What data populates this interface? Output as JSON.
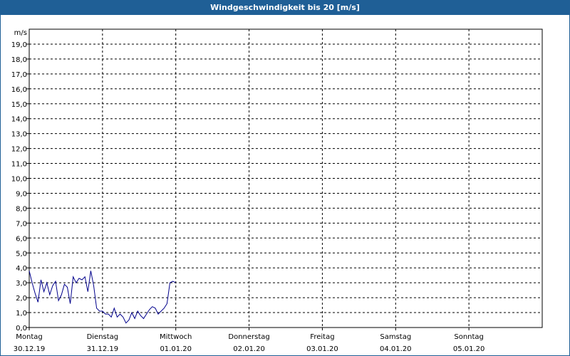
{
  "window": {
    "title": "Windgeschwindigkeit bis 20 [m/s]"
  },
  "colors": {
    "titlebar": "#1f5f96",
    "series": "#00008b",
    "grid": "#000000"
  },
  "chart_data": {
    "type": "line",
    "title": "Windgeschwindigkeit bis 20 [m/s]",
    "ylabel": "m/s",
    "ylim": [
      0,
      20
    ],
    "y_ticks": [
      "0,0",
      "1,0",
      "2,0",
      "3,0",
      "4,0",
      "5,0",
      "6,0",
      "7,0",
      "8,0",
      "9,0",
      "10,0",
      "11,0",
      "12,0",
      "13,0",
      "14,0",
      "15,0",
      "16,0",
      "17,0",
      "18,0",
      "19,0"
    ],
    "x_unit": "days since 30.12.19",
    "xlim": [
      0,
      7
    ],
    "x_ticks": [
      {
        "day": "Montag",
        "date": "30.12.19"
      },
      {
        "day": "Dienstag",
        "date": "31.12.19"
      },
      {
        "day": "Mittwoch",
        "date": "01.01.20"
      },
      {
        "day": "Donnerstag",
        "date": "02.01.20"
      },
      {
        "day": "Freitag",
        "date": "03.01.20"
      },
      {
        "day": "Samstag",
        "date": "04.01.20"
      },
      {
        "day": "Sonntag",
        "date": "05.01.20"
      }
    ],
    "grid": true,
    "series": [
      {
        "name": "",
        "x": [
          0.0,
          0.04,
          0.08,
          0.12,
          0.16,
          0.2,
          0.24,
          0.28,
          0.32,
          0.36,
          0.4,
          0.44,
          0.48,
          0.52,
          0.56,
          0.6,
          0.64,
          0.68,
          0.72,
          0.76,
          0.8,
          0.84,
          0.88,
          0.92,
          0.96,
          1.0,
          1.04,
          1.08,
          1.12,
          1.16,
          1.2,
          1.24,
          1.28,
          1.32,
          1.36,
          1.4,
          1.44,
          1.48,
          1.52,
          1.56,
          1.6,
          1.64,
          1.68,
          1.72,
          1.76,
          1.8,
          1.84,
          1.88,
          1.92,
          1.96,
          2.0
        ],
        "y": [
          3.8,
          3.0,
          2.3,
          1.7,
          3.2,
          2.4,
          3.0,
          2.2,
          2.8,
          3.1,
          1.8,
          2.2,
          2.9,
          2.7,
          1.6,
          3.4,
          3.0,
          3.3,
          3.2,
          3.4,
          2.4,
          3.8,
          2.8,
          1.3,
          1.1,
          1.1,
          0.9,
          0.9,
          0.7,
          1.3,
          0.7,
          0.9,
          0.7,
          0.3,
          0.5,
          1.0,
          0.6,
          1.1,
          0.8,
          0.6,
          0.9,
          1.2,
          1.4,
          1.3,
          0.9,
          1.1,
          1.3,
          1.6,
          3.0,
          3.1,
          3.0
        ]
      }
    ]
  }
}
